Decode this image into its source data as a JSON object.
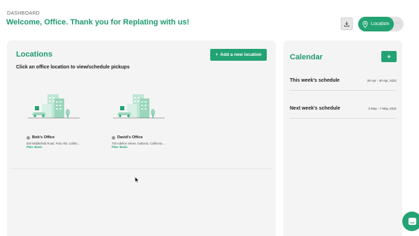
{
  "header": {
    "breadcrumb": "DASHBOARD",
    "welcome": "Welcome, Office. Thank you for Replating with us!"
  },
  "toolbar": {
    "download_icon": "download-icon",
    "view_toggle": {
      "active_label": "Location",
      "active_icon": "map-pin-icon",
      "inactive_icon": "calendar-icon"
    }
  },
  "locations": {
    "title": "Locations",
    "add_button_label": "Add a new location",
    "instruction": "Click an office location to view/schedule pickups",
    "items": [
      {
        "name": "Bob's Office",
        "address": "500 Middlefield Road, Palo Alto, Califor...",
        "plan": "Plan: Basic"
      },
      {
        "name": "David's Office",
        "address": "700 Adeline Street, Oakland, California ...",
        "plan": "Plan: Basic"
      }
    ]
  },
  "calendar": {
    "title": "Calendar",
    "add_label": "+",
    "rows": [
      {
        "label": "This week's schedule",
        "dates": "26 Apr - 30 Apr, 2021"
      },
      {
        "label": "Next week's schedule",
        "dates": "3 May - 7 May, 2021"
      }
    ]
  },
  "colors": {
    "brand_green": "#23a374",
    "heading_green": "#1f9a6e",
    "panel_bg": "#f4f4f5"
  }
}
